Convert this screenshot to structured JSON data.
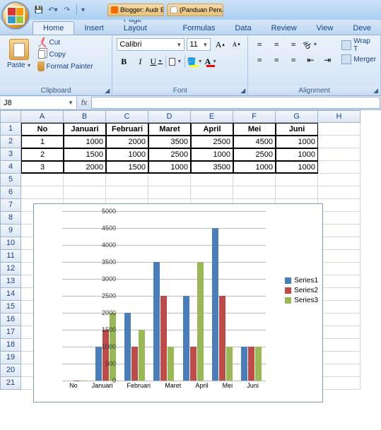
{
  "qat": {
    "save": "save-icon",
    "undo": "undo-icon",
    "redo": "redo-icon"
  },
  "browser_tabs": [
    "Blogger: Audr B...",
    "(Panduan Penul..."
  ],
  "tabs": [
    "Home",
    "Insert",
    "Page Layout",
    "Formulas",
    "Data",
    "Review",
    "View",
    "Deve"
  ],
  "active_tab": "Home",
  "clipboard": {
    "paste": "Paste",
    "cut": "Cut",
    "copy": "Copy",
    "fp": "Format Painter",
    "group": "Clipboard"
  },
  "font": {
    "group": "Font",
    "name": "Calibri",
    "size": "11",
    "bold": "B",
    "italic": "I",
    "underline": "U",
    "grow": "A",
    "shrink": "A",
    "fill_label": "fill",
    "color_label": "font color"
  },
  "alignment": {
    "group": "Alignment",
    "wrap": "Wrap T",
    "merge": "Merger"
  },
  "namebox": "J8",
  "fx": "fx",
  "columns": [
    "A",
    "B",
    "C",
    "D",
    "E",
    "F",
    "G",
    "H"
  ],
  "rows": [
    "1",
    "2",
    "3",
    "4",
    "5",
    "6",
    "7",
    "8",
    "9",
    "10",
    "11",
    "12",
    "13",
    "14",
    "15",
    "16",
    "17",
    "18",
    "19",
    "20",
    "21"
  ],
  "table": {
    "headers": [
      "No",
      "Januari",
      "Februari",
      "Maret",
      "April",
      "Mei",
      "Juni"
    ],
    "data": [
      [
        "1",
        "1000",
        "2000",
        "3500",
        "2500",
        "4500",
        "1000"
      ],
      [
        "2",
        "1500",
        "1000",
        "2500",
        "1000",
        "2500",
        "1000"
      ],
      [
        "3",
        "2000",
        "1500",
        "1000",
        "3500",
        "1000",
        "1000"
      ]
    ]
  },
  "chart_data": {
    "type": "bar",
    "categories": [
      "No",
      "Januari",
      "Februari",
      "Maret",
      "April",
      "Mei",
      "Juni"
    ],
    "series": [
      {
        "name": "Series1",
        "values": [
          1,
          1000,
          2000,
          3500,
          2500,
          4500,
          1000
        ],
        "color": "#4a7ebb"
      },
      {
        "name": "Series2",
        "values": [
          2,
          1500,
          1000,
          2500,
          1000,
          2500,
          1000
        ],
        "color": "#be4b48"
      },
      {
        "name": "Series3",
        "values": [
          3,
          2000,
          1500,
          1000,
          3500,
          1000,
          1000
        ],
        "color": "#98b954"
      }
    ],
    "ylim": [
      0,
      5000
    ],
    "ytick": 500,
    "title": "",
    "xlabel": "",
    "ylabel": ""
  }
}
